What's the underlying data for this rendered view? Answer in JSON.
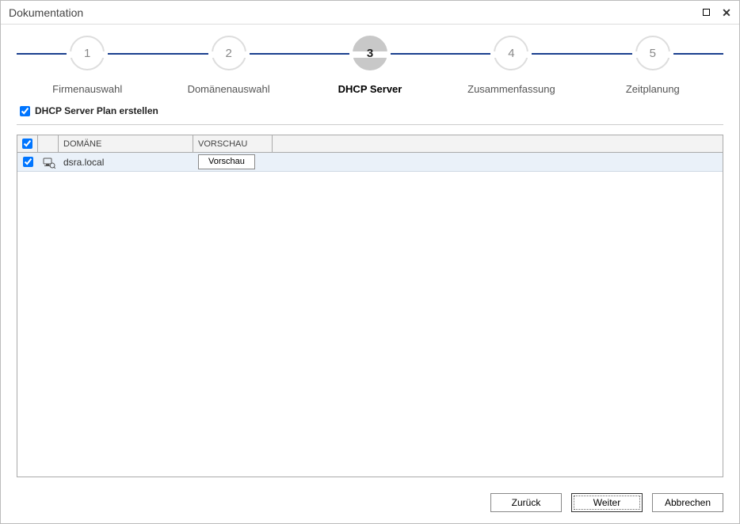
{
  "window": {
    "title": "Dokumentation"
  },
  "wizard": {
    "steps": [
      {
        "num": "1",
        "label": "Firmenauswahl",
        "active": false
      },
      {
        "num": "2",
        "label": "Domänenauswahl",
        "active": false
      },
      {
        "num": "3",
        "label": "DHCP Server",
        "active": true
      },
      {
        "num": "4",
        "label": "Zusammenfassung",
        "active": false
      },
      {
        "num": "5",
        "label": "Zeitplanung",
        "active": false
      }
    ]
  },
  "plan": {
    "label": "DHCP Server Plan erstellen",
    "checked": true
  },
  "table": {
    "headers": {
      "domain": "DOMÄNE",
      "preview": "VORSCHAU"
    },
    "rows": [
      {
        "checked": true,
        "domain": "dsra.local",
        "preview_btn": "Vorschau"
      }
    ]
  },
  "buttons": {
    "back": "Zurück",
    "next": "Weiter",
    "cancel": "Abbrechen"
  }
}
